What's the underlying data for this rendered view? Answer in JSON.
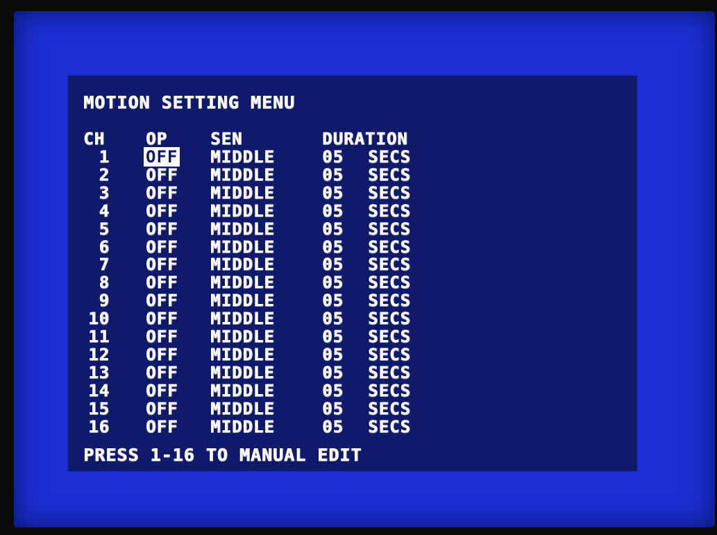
{
  "menu": {
    "title": "MOTION SETTING MENU",
    "headers": {
      "ch": "CH",
      "op": "OP",
      "sen": "SEN",
      "duration": "DURATION"
    },
    "rows": [
      {
        "ch": "1",
        "op": "OFF",
        "sen": "MIDDLE",
        "duration": "05",
        "unit": "SECS",
        "selected": true
      },
      {
        "ch": "2",
        "op": "OFF",
        "sen": "MIDDLE",
        "duration": "05",
        "unit": "SECS"
      },
      {
        "ch": "3",
        "op": "OFF",
        "sen": "MIDDLE",
        "duration": "05",
        "unit": "SECS"
      },
      {
        "ch": "4",
        "op": "OFF",
        "sen": "MIDDLE",
        "duration": "05",
        "unit": "SECS"
      },
      {
        "ch": "5",
        "op": "OFF",
        "sen": "MIDDLE",
        "duration": "05",
        "unit": "SECS"
      },
      {
        "ch": "6",
        "op": "OFF",
        "sen": "MIDDLE",
        "duration": "05",
        "unit": "SECS"
      },
      {
        "ch": "7",
        "op": "OFF",
        "sen": "MIDDLE",
        "duration": "05",
        "unit": "SECS"
      },
      {
        "ch": "8",
        "op": "OFF",
        "sen": "MIDDLE",
        "duration": "05",
        "unit": "SECS"
      },
      {
        "ch": "9",
        "op": "OFF",
        "sen": "MIDDLE",
        "duration": "05",
        "unit": "SECS"
      },
      {
        "ch": "10",
        "op": "OFF",
        "sen": "MIDDLE",
        "duration": "05",
        "unit": "SECS"
      },
      {
        "ch": "11",
        "op": "OFF",
        "sen": "MIDDLE",
        "duration": "05",
        "unit": "SECS"
      },
      {
        "ch": "12",
        "op": "OFF",
        "sen": "MIDDLE",
        "duration": "05",
        "unit": "SECS"
      },
      {
        "ch": "13",
        "op": "OFF",
        "sen": "MIDDLE",
        "duration": "05",
        "unit": "SECS"
      },
      {
        "ch": "14",
        "op": "OFF",
        "sen": "MIDDLE",
        "duration": "05",
        "unit": "SECS"
      },
      {
        "ch": "15",
        "op": "OFF",
        "sen": "MIDDLE",
        "duration": "05",
        "unit": "SECS"
      },
      {
        "ch": "16",
        "op": "OFF",
        "sen": "MIDDLE",
        "duration": "05",
        "unit": "SECS"
      }
    ],
    "footer": "PRESS 1-16 TO MANUAL EDIT"
  },
  "colors": {
    "screen_bg": "#1a2ed2",
    "panel_bg": "#101a6a",
    "text": "#ffffff",
    "highlight_bg": "#ffffff"
  }
}
